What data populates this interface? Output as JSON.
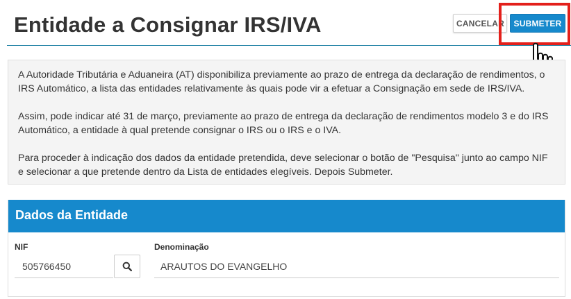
{
  "page": {
    "title": "Entidade a Consignar IRS/IVA"
  },
  "toolbar": {
    "cancel_label": "CANCELAR",
    "submit_label": "SUBMETER",
    "highlight_color": "#e3201b",
    "accent_color": "#1689cc"
  },
  "info": {
    "paragraphs": [
      "A Autoridade Tributária e Aduaneira (AT) disponibiliza previamente ao prazo de entrega da declaração de rendimentos, o IRS Automático, a lista das entidades relativamente às quais pode vir a efetuar a Consignação em sede de IRS/IVA.",
      "Assim, pode indicar até 31 de março, previamente ao prazo de entrega da declaração de rendimentos modelo 3 e do IRS Automático, a entidade à qual pretende consignar o IRS ou o IRS e o IVA.",
      "Para proceder à indicação dos dados da entidade pretendida, deve selecionar o botão de \"Pesquisa\" junto ao campo NIF e selecionar a que pretende dentro da Lista de entidades elegíveis. Depois Submeter."
    ]
  },
  "entity_panel": {
    "title": "Dados da Entidade",
    "nif_label": "NIF",
    "nif_value": "505766450",
    "denominacao_label": "Denominação",
    "denominacao_value": "ARAUTOS DO EVANGELHO"
  },
  "icons": {
    "search": "search-icon",
    "pointer": "hand-pointer-icon"
  }
}
